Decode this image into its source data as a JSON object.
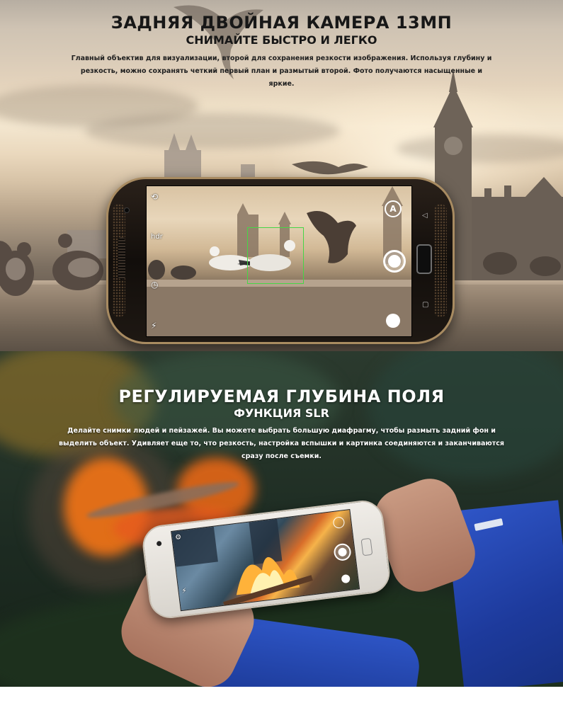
{
  "section_camera": {
    "title": "ЗАДНЯЯ ДВОЙНАЯ КАМЕРА 13МП",
    "subtitle": "СНИМАЙТЕ БЫСТРО И ЛЕГКО",
    "description": "Главный объектив для визуализации, второй для сохранения резкости изображения. Используя глубину и резкость, можно сохранять четкий первый план и размытый второй. Фото получаются насыщенные и яркие.",
    "viewfinder_mode_label": "A"
  },
  "section_depth": {
    "title": "РЕГУЛИРУЕМАЯ ГЛУБИНА ПОЛЯ",
    "subtitle": "ФУНКЦИЯ SLR",
    "description": "Делайте снимки людей и пейзажей. Вы можете выбрать большую диафрагму, чтобы размыть задний фон и выделить объект. Удивляет еще то, что резкость, настройка вспышки и картинка соединяются и заканчиваются сразу после съемки."
  },
  "colors": {
    "focus_box": "#46d646",
    "title_dark": "#171717",
    "title_light": "#ffffff",
    "sleeve_blue": "#2f56c8"
  }
}
